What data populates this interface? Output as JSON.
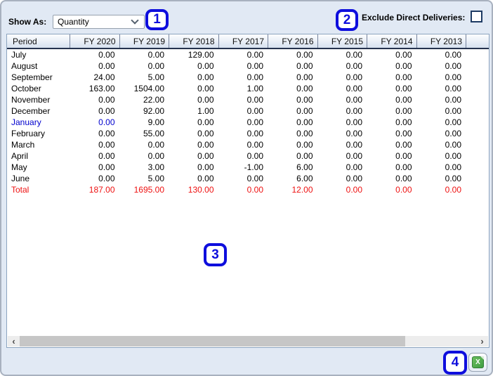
{
  "colors": {
    "annotation": "#0e0edd",
    "january_row": "#0000cd",
    "total_row": "#ee1111"
  },
  "toolbar": {
    "show_as_label": "Show As:",
    "show_as_value": "Quantity",
    "exclude_label": "Exclude Direct Deliveries:",
    "exclude_checked": false
  },
  "annotations": {
    "a1": "1",
    "a2": "2",
    "a3": "3",
    "a4": "4"
  },
  "table": {
    "columns": [
      "Period",
      "FY 2020",
      "FY 2019",
      "FY 2018",
      "FY 2017",
      "FY 2016",
      "FY 2015",
      "FY 2014",
      "FY 2013"
    ],
    "rows": [
      {
        "period": "July",
        "values": [
          "0.00",
          "0.00",
          "129.00",
          "0.00",
          "0.00",
          "0.00",
          "0.00",
          "0.00"
        ],
        "style": "normal"
      },
      {
        "period": "August",
        "values": [
          "0.00",
          "0.00",
          "0.00",
          "0.00",
          "0.00",
          "0.00",
          "0.00",
          "0.00"
        ],
        "style": "normal"
      },
      {
        "period": "September",
        "values": [
          "24.00",
          "5.00",
          "0.00",
          "0.00",
          "0.00",
          "0.00",
          "0.00",
          "0.00"
        ],
        "style": "normal"
      },
      {
        "period": "October",
        "values": [
          "163.00",
          "1504.00",
          "0.00",
          "1.00",
          "0.00",
          "0.00",
          "0.00",
          "0.00"
        ],
        "style": "normal"
      },
      {
        "period": "November",
        "values": [
          "0.00",
          "22.00",
          "0.00",
          "0.00",
          "0.00",
          "0.00",
          "0.00",
          "0.00"
        ],
        "style": "normal"
      },
      {
        "period": "December",
        "values": [
          "0.00",
          "92.00",
          "1.00",
          "0.00",
          "0.00",
          "0.00",
          "0.00",
          "0.00"
        ],
        "style": "normal"
      },
      {
        "period": "January",
        "values": [
          "0.00",
          "9.00",
          "0.00",
          "0.00",
          "0.00",
          "0.00",
          "0.00",
          "0.00"
        ],
        "style": "highlight-first"
      },
      {
        "period": "February",
        "values": [
          "0.00",
          "55.00",
          "0.00",
          "0.00",
          "0.00",
          "0.00",
          "0.00",
          "0.00"
        ],
        "style": "normal"
      },
      {
        "period": "March",
        "values": [
          "0.00",
          "0.00",
          "0.00",
          "0.00",
          "0.00",
          "0.00",
          "0.00",
          "0.00"
        ],
        "style": "normal"
      },
      {
        "period": "April",
        "values": [
          "0.00",
          "0.00",
          "0.00",
          "0.00",
          "0.00",
          "0.00",
          "0.00",
          "0.00"
        ],
        "style": "normal"
      },
      {
        "period": "May",
        "values": [
          "0.00",
          "3.00",
          "0.00",
          "-1.00",
          "6.00",
          "0.00",
          "0.00",
          "0.00"
        ],
        "style": "normal"
      },
      {
        "period": "June",
        "values": [
          "0.00",
          "5.00",
          "0.00",
          "0.00",
          "6.00",
          "0.00",
          "0.00",
          "0.00"
        ],
        "style": "normal"
      },
      {
        "period": "Total",
        "values": [
          "187.00",
          "1695.00",
          "130.00",
          "0.00",
          "12.00",
          "0.00",
          "0.00",
          "0.00"
        ],
        "style": "total"
      }
    ]
  },
  "scrollbar": {
    "left_arrow_glyph": "‹",
    "right_arrow_glyph": "›"
  },
  "footer": {
    "excel_icon_glyph": "X"
  }
}
